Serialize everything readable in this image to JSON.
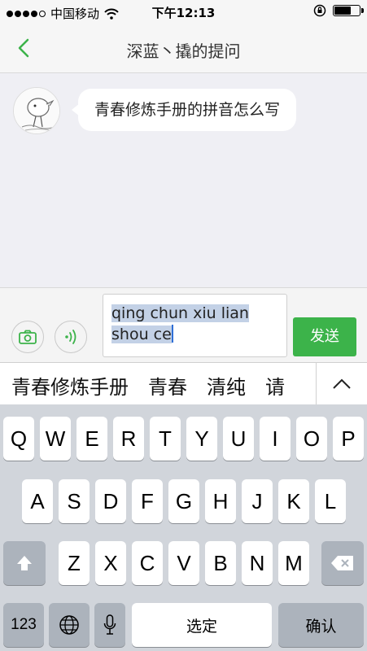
{
  "status_bar": {
    "carrier": "中国移动",
    "time": "下午12:13",
    "battery_level": 0.7
  },
  "nav": {
    "title": "深蓝丶撬的提问"
  },
  "chat": {
    "message": "青春修炼手册的拼音怎么写"
  },
  "composer": {
    "text_line1": "qing chun xiu lian",
    "text_line2": "shou ce",
    "send_label": "发送"
  },
  "candidates": [
    "青春修炼手册",
    "青春",
    "清纯",
    "请"
  ],
  "keyboard": {
    "row1": [
      "Q",
      "W",
      "E",
      "R",
      "T",
      "Y",
      "U",
      "I",
      "O",
      "P"
    ],
    "row2": [
      "A",
      "S",
      "D",
      "F",
      "G",
      "H",
      "J",
      "K",
      "L"
    ],
    "row3": [
      "Z",
      "X",
      "C",
      "V",
      "B",
      "N",
      "M"
    ],
    "numbers_label": "123",
    "space_label": "选定",
    "return_label": "确认"
  }
}
